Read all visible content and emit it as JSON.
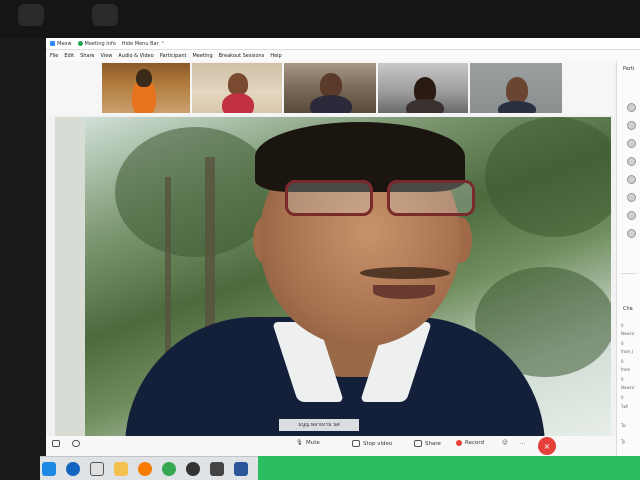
{
  "window": {
    "title_app": "Meow",
    "title_meeting_info": "Meeting Info",
    "title_hide_menu": "Hide Menu Bar"
  },
  "menu": [
    "File",
    "Edit",
    "Share",
    "View",
    "Audio & Video",
    "Participant",
    "Meeting",
    "Breakout Sessions",
    "Help"
  ],
  "video": {
    "speaker_name": "มนูญ พลายงาม นศ"
  },
  "right_panel": {
    "participants_title": "Parti",
    "chat_title": "Cha",
    "chat_lines": [
      "0",
      "Newco",
      "0",
      "from J",
      "0",
      "from",
      "0",
      "Newco",
      "0",
      "ใจดี",
      "To:",
      "Ty"
    ]
  },
  "controls": {
    "mute": "Mute",
    "stop_video": "Stop video",
    "share": "Share",
    "record": "Record",
    "more": "...",
    "end": "×"
  },
  "colors": {
    "accent": "#2d8cff",
    "end_red": "#e5403a",
    "taskbar_green": "#2bbd5f"
  },
  "taskbar_icons": [
    "windows-logo-icon",
    "edge-icon",
    "qr-app-icon",
    "file-explorer-icon",
    "firefox-icon",
    "chrome-icon",
    "obs-icon",
    "davinci-icon",
    "word-icon"
  ]
}
